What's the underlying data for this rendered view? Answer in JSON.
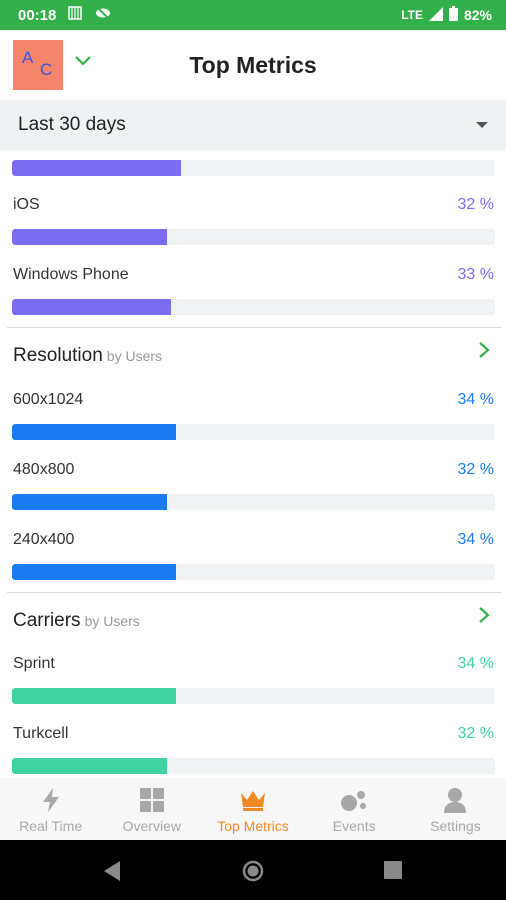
{
  "status_bar": {
    "time": "00:18",
    "network": "LTE",
    "battery": "82%"
  },
  "header": {
    "title": "Top Metrics",
    "logo_letters": [
      "A",
      "C"
    ]
  },
  "period": {
    "selected": "Last 30 days"
  },
  "top_partial_row": {
    "value": 0.35,
    "color": "#7b6cf0"
  },
  "platforms": [
    {
      "label": "iOS",
      "pct": "32 %",
      "value": 0.32
    },
    {
      "label": "Windows Phone",
      "pct": "33 %",
      "value": 0.33
    }
  ],
  "resolution": {
    "title": "Resolution",
    "sub": "by Users",
    "color": "#1a7cf0",
    "rows": [
      {
        "label": "600x1024",
        "pct": "34 %",
        "value": 0.34
      },
      {
        "label": "480x800",
        "pct": "32 %",
        "value": 0.32
      },
      {
        "label": "240x400",
        "pct": "34 %",
        "value": 0.34
      }
    ]
  },
  "carriers": {
    "title": "Carriers",
    "sub": "by Users",
    "color": "#3ed3a0",
    "rows": [
      {
        "label": "Sprint",
        "pct": "34 %",
        "value": 0.34
      },
      {
        "label": "Turkcell",
        "pct": "32 %",
        "value": 0.32
      }
    ]
  },
  "colors": {
    "platform": "#7b6cf0",
    "resolution": "#1a7cf0",
    "carriers": "#3ed3a0",
    "accent_green": "#34b04a",
    "active_tab": "#f08a24"
  },
  "bottom_nav": [
    {
      "label": "Real Time",
      "icon": "lightning-icon",
      "active": false
    },
    {
      "label": "Overview",
      "icon": "grid-icon",
      "active": false
    },
    {
      "label": "Top Metrics",
      "icon": "crown-icon",
      "active": true
    },
    {
      "label": "Events",
      "icon": "dots-icon",
      "active": false
    },
    {
      "label": "Settings",
      "icon": "user-icon",
      "active": false
    }
  ]
}
